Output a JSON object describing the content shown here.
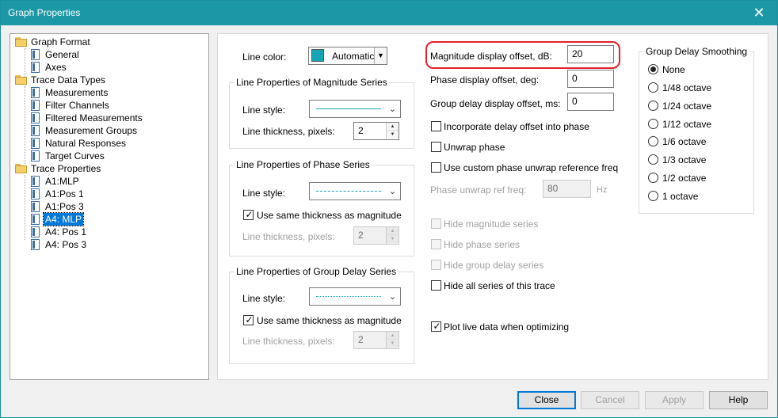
{
  "window": {
    "title": "Graph Properties",
    "close_glyph": "✕"
  },
  "tree": {
    "items": [
      {
        "label": "Graph Format",
        "icon": "folder-icon",
        "level": 0
      },
      {
        "label": "General",
        "icon": "doc-icon",
        "level": 1
      },
      {
        "label": "Axes",
        "icon": "doc-icon",
        "level": 1
      },
      {
        "label": "Trace Data Types",
        "icon": "folder-icon",
        "level": 0
      },
      {
        "label": "Measurements",
        "icon": "doc-icon",
        "level": 1
      },
      {
        "label": "Filter Channels",
        "icon": "doc-icon",
        "level": 1
      },
      {
        "label": "Filtered Measurements",
        "icon": "doc-icon",
        "level": 1
      },
      {
        "label": "Measurement Groups",
        "icon": "doc-icon",
        "level": 1
      },
      {
        "label": "Natural Responses",
        "icon": "doc-icon",
        "level": 1
      },
      {
        "label": "Target Curves",
        "icon": "doc-icon",
        "level": 1
      },
      {
        "label": "Trace Properties",
        "icon": "folder-icon",
        "level": 0
      },
      {
        "label": "A1:MLP",
        "icon": "doc-icon",
        "level": 1
      },
      {
        "label": "A1:Pos 1",
        "icon": "doc-icon",
        "level": 1
      },
      {
        "label": "A1:Pos 3",
        "icon": "doc-icon",
        "level": 1
      },
      {
        "label": "A4: MLP",
        "icon": "doc-icon",
        "level": 1,
        "selected": true
      },
      {
        "label": "A4: Pos 1",
        "icon": "doc-icon",
        "level": 1
      },
      {
        "label": "A4: Pos 3",
        "icon": "doc-icon",
        "level": 1
      }
    ]
  },
  "line_color": {
    "label": "Line color:",
    "value": "Automatic",
    "swatch_color": "#16a5b5"
  },
  "magnitude_group": {
    "legend": "Line Properties of Magnitude Series",
    "style_label": "Line style:",
    "thickness_label": "Line thickness, pixels:",
    "thickness_value": "2"
  },
  "phase_group": {
    "legend": "Line Properties of Phase Series",
    "style_label": "Line style:",
    "same_thickness_label": "Use same thickness as magnitude",
    "thickness_label": "Line thickness, pixels:",
    "thickness_value": "2"
  },
  "group_delay_group": {
    "legend": "Line Properties of Group Delay Series",
    "style_label": "Line style:",
    "same_thickness_label": "Use same thickness as magnitude",
    "thickness_label": "Line thickness, pixels:",
    "thickness_value": "2"
  },
  "offsets": {
    "magnitude_label": "Magnitude display offset, dB:",
    "magnitude_value": "20",
    "phase_label": "Phase display offset, deg:",
    "phase_value": "0",
    "group_delay_label": "Group delay display offset, ms:",
    "group_delay_value": "0"
  },
  "options": {
    "incorporate_delay": "Incorporate delay offset into phase",
    "unwrap_phase": "Unwrap phase",
    "custom_unwrap": "Use custom phase unwrap reference freq",
    "unwrap_ref_label": "Phase unwrap ref freq:",
    "unwrap_ref_value": "80",
    "unwrap_ref_unit": "Hz",
    "hide_magnitude": "Hide magnitude series",
    "hide_phase": "Hide phase series",
    "hide_group_delay": "Hide group delay series",
    "hide_all": "Hide all series of this trace",
    "plot_live": "Plot live data when optimizing"
  },
  "smoothing": {
    "legend": "Group Delay Smoothing",
    "options": [
      "None",
      "1/48 octave",
      "1/24 octave",
      "1/12 octave",
      "1/6 octave",
      "1/3 octave",
      "1/2 octave",
      "1 octave"
    ],
    "selected": "None"
  },
  "buttons": {
    "close": "Close",
    "cancel": "Cancel",
    "apply": "Apply",
    "help": "Help"
  },
  "colors": {
    "titlebar": "#1b97a6",
    "highlight": "#e3202d",
    "selection": "#0078d7",
    "line_series": "#16a5b5"
  }
}
